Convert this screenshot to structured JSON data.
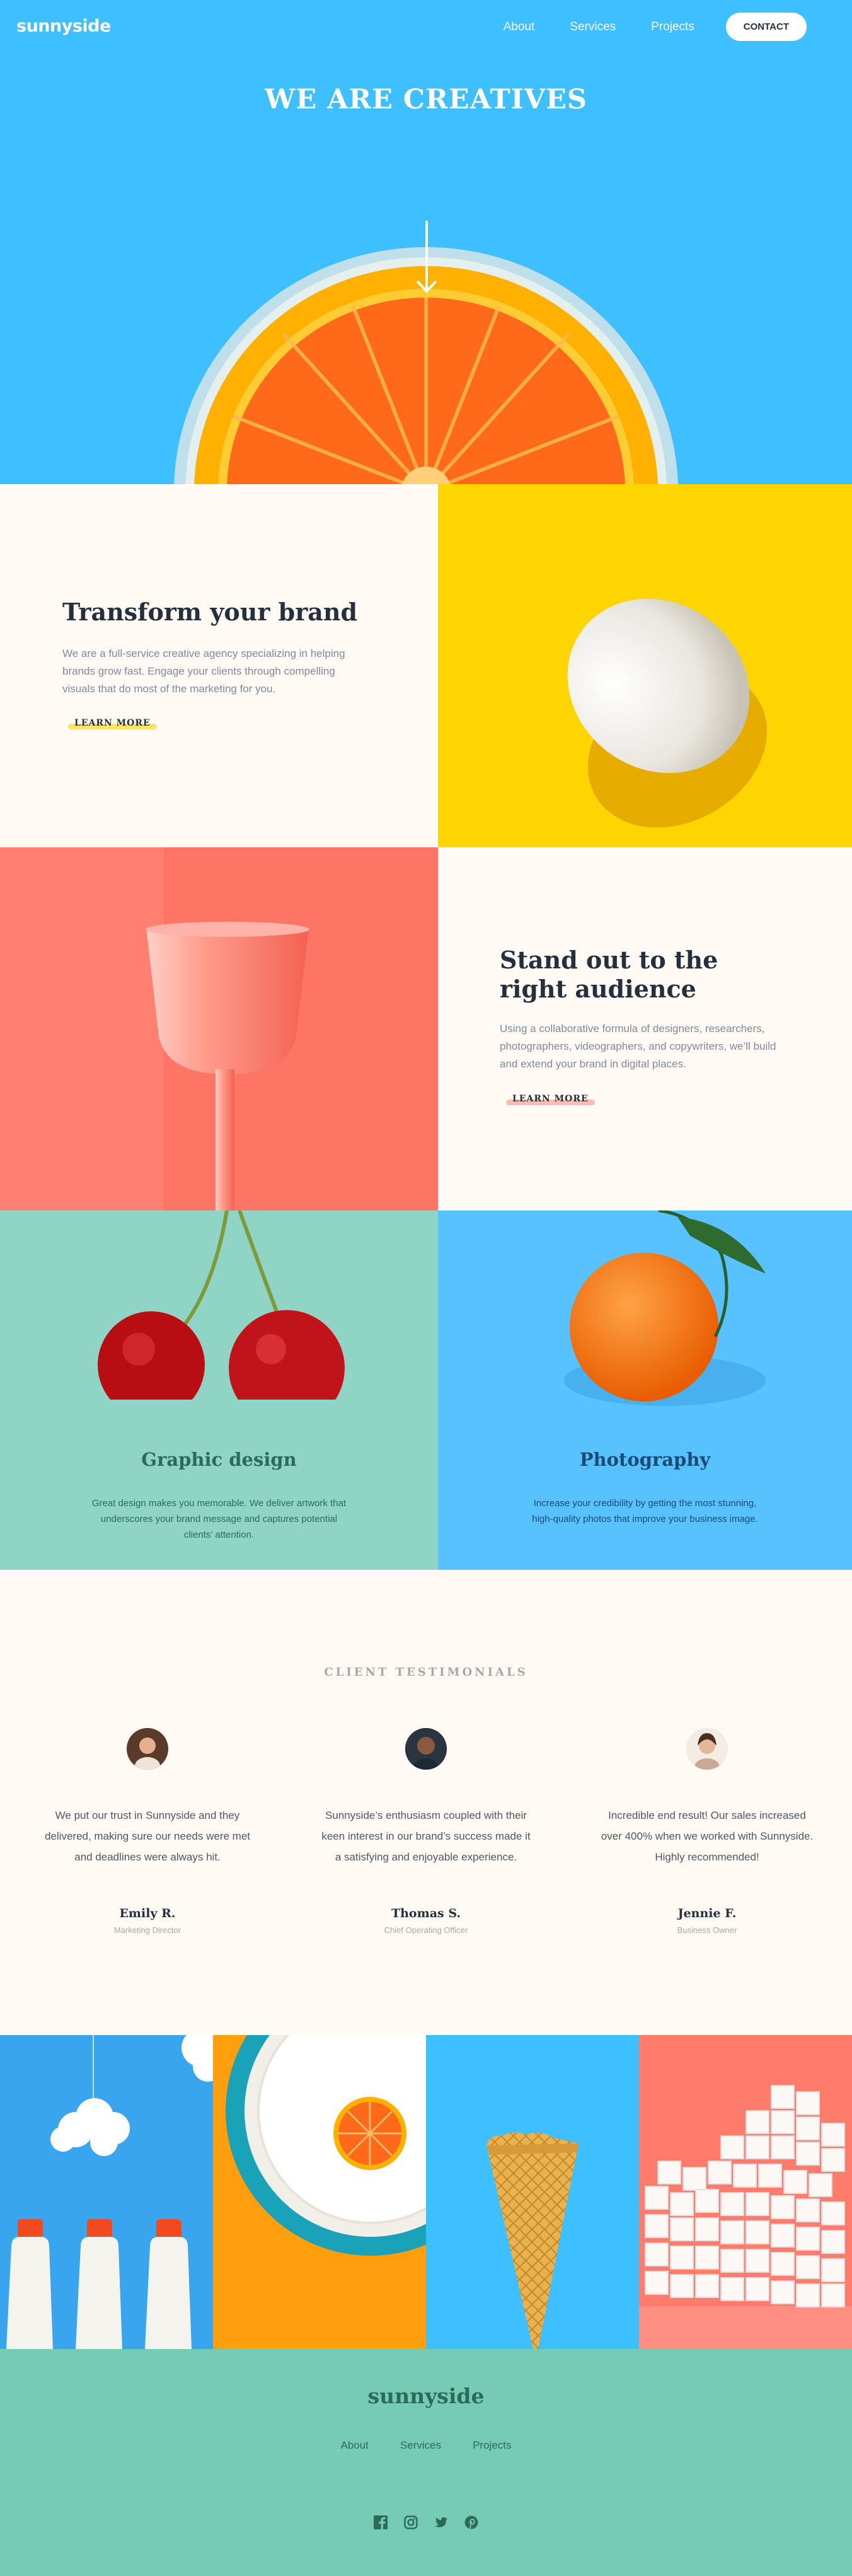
{
  "header": {
    "logo": "sunnyside",
    "nav": [
      {
        "label": "About"
      },
      {
        "label": "Services"
      },
      {
        "label": "Projects"
      }
    ],
    "contact_label": "CONTACT"
  },
  "hero": {
    "title": "WE ARE CREATIVES",
    "image": "orange-half-icon",
    "scroll_icon": "arrow-down-icon"
  },
  "features": [
    {
      "title": "Transform your brand",
      "body": "We are a full-service creative agency specializing in helping brands grow fast. Engage your clients through compelling visuals that do most of the marketing for you.",
      "link": "LEARN MORE",
      "underline_color": "#fad400",
      "image": "egg-image"
    },
    {
      "title": "Stand out to the right audience",
      "body": "Using a collaborative formula of designers, researchers, photographers, videographers, and copywriters, we’ll build and extend your brand in digital places.",
      "link": "LEARN MORE",
      "underline_color": "#fd8a7e",
      "image": "cup-image"
    }
  ],
  "services": [
    {
      "title": "Graphic design",
      "body": "Great design makes you memorable. We deliver artwork that underscores your brand message and captures potential clients’ attention.",
      "title_color": "#2c6a5a",
      "text_color": "#2c6a5a",
      "image": "cherries-image"
    },
    {
      "title": "Photography",
      "body": "Increase your credibility by getting the most stunning, high-quality photos that improve your business image.",
      "title_color": "#1b4a73",
      "text_color": "#1b4a73",
      "image": "orange-image"
    }
  ],
  "testimonials": {
    "heading": "CLIENT TESTIMONIALS",
    "items": [
      {
        "quote": "We put our trust in Sunnyside and they delivered, making sure our needs were met and deadlines were always hit.",
        "name": "Emily R.",
        "role": "Marketing Director"
      },
      {
        "quote": "Sunnyside’s enthusiasm coupled with their keen interest in our brand’s success made it a satisfying and enjoyable experience.",
        "name": "Thomas S.",
        "role": "Chief Operating Officer"
      },
      {
        "quote": "Incredible end result! Our sales increased over 400% when we worked with Sunnyside. Highly recommended!",
        "name": "Jennie F.",
        "role": "Business Owner"
      }
    ]
  },
  "gallery": [
    "milk-bottles-image",
    "orange-plate-image",
    "ice-cream-cone-image",
    "sugar-cubes-image"
  ],
  "footer": {
    "logo": "sunnyside",
    "nav": [
      {
        "label": "About"
      },
      {
        "label": "Services"
      },
      {
        "label": "Projects"
      }
    ],
    "socials": [
      "facebook-icon",
      "instagram-icon",
      "twitter-icon",
      "pinterest-icon"
    ]
  },
  "colors": {
    "hero_bg": "#3ebfff",
    "yellow": "#fed501",
    "coral": "#ff6e5e",
    "mint": "#90d4c5",
    "footer_bg": "#76cbb5",
    "dark_text": "#24303d"
  }
}
